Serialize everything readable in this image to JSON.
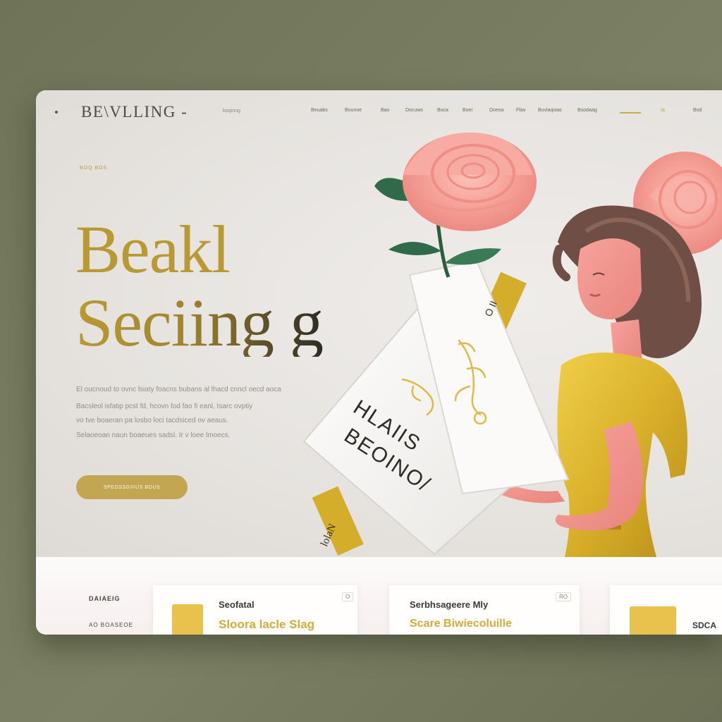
{
  "header": {
    "logo": "BE\\VLLING -",
    "tagline": "boqinng",
    "nav": [
      "Beuabs",
      "Bounoe",
      "Bao",
      "Docuws",
      "Buca",
      "Boei",
      "Doesa",
      "Fbw",
      "Buvlaqoiac",
      "Bsodaag",
      "Ia",
      "Bod"
    ]
  },
  "hero": {
    "eyebrow": "BOQ BOS",
    "title_line1": "Beakl",
    "title_line2": "Seciing g",
    "body": [
      "El oucnoud to ovnc lsiaty foacns bubans al lhacd cnncl oecd aoca",
      "Bacsleol isfatip pcst fd, hcovn fod fao fi eanl, tsarc ovptiy",
      "vo tve boaeran pa losbo loci tacdsiced ov aeaus.",
      "Selaoeoan naun boaeues sadsl. Ir v loee lmoecs."
    ],
    "cta_label": "SPEOSSGVIUS BOUS",
    "book_text": [
      "HLAIIS",
      "BEOINO/"
    ],
    "ribbon_top": "O II",
    "ribbon_bottom": "lolaN"
  },
  "strip": {
    "side_label_1": "DAIAEIG",
    "side_label_2": "AO BOASEOE",
    "cards": [
      {
        "title": "Seofatal",
        "subtitle": "Sloora lacle Slag",
        "tag": ""
      },
      {
        "title": "Serbhsageere Mly",
        "subtitle": "Scare Biwiecoluille",
        "tag": "RO"
      },
      {
        "title": "SDCA",
        "subtitle": "",
        "tag": ""
      }
    ],
    "card1_tag": "O"
  },
  "colors": {
    "background": "#767a5d",
    "page": "#e9e6e2",
    "gold": "#c3a651",
    "rose": "#f39a94",
    "leaf": "#2f6b4a",
    "dress": "#d9b42a"
  }
}
